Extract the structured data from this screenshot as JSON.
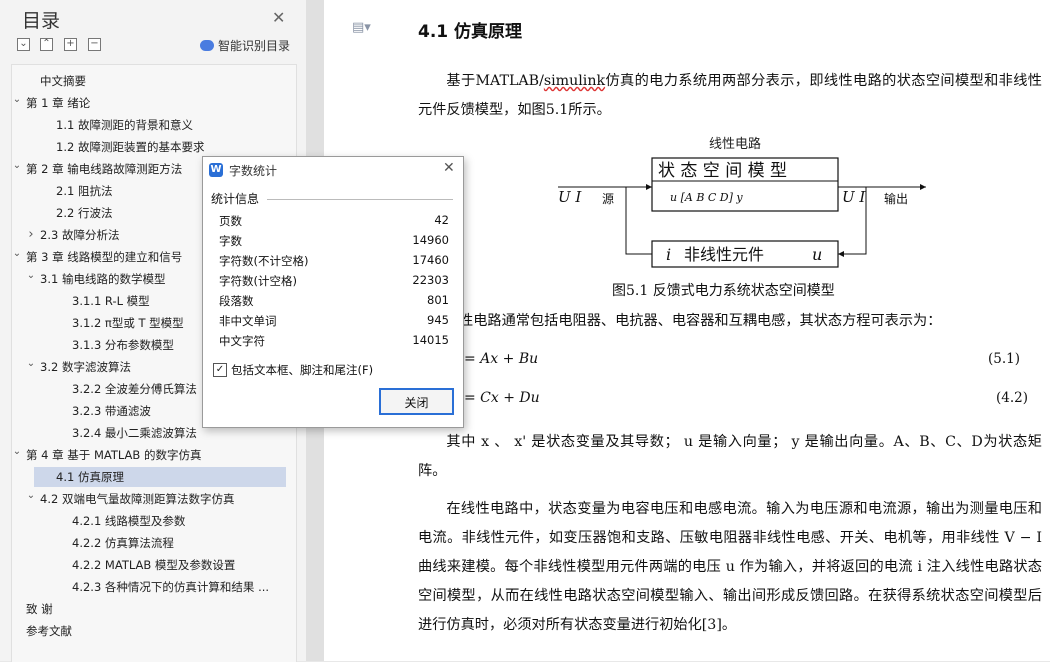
{
  "sidebar": {
    "title": "目录",
    "smart_label": "智能识别目录",
    "toolbar": [
      "⌄",
      "⌃",
      "+",
      "−"
    ],
    "items": [
      {
        "label": "中文摘要",
        "level": 1,
        "caret": ""
      },
      {
        "label": "第 1 章  绪论",
        "level": 0,
        "caret": "v"
      },
      {
        "label": "1.1 故障测距的背景和意义",
        "level": 2,
        "caret": ""
      },
      {
        "label": "1.2 故障测距装置的基本要求",
        "level": 2,
        "caret": ""
      },
      {
        "label": "第 2 章  输电线路故障测距方法",
        "level": 0,
        "caret": "v"
      },
      {
        "label": "2.1 阻抗法",
        "level": 2,
        "caret": ""
      },
      {
        "label": "2.2 行波法",
        "level": 2,
        "caret": ""
      },
      {
        "label": "2.3 故障分析法",
        "level": 1,
        "caret": ">"
      },
      {
        "label": "第 3 章  线路模型的建立和信号",
        "level": 0,
        "caret": "v"
      },
      {
        "label": "3.1 输电线路的数学模型",
        "level": 1,
        "caret": "v"
      },
      {
        "label": "3.1.1 R-L 模型",
        "level": 3,
        "caret": ""
      },
      {
        "label": "3.1.2 π型或 T 型模型",
        "level": 3,
        "caret": ""
      },
      {
        "label": "3.1.3  分布参数模型",
        "level": 3,
        "caret": ""
      },
      {
        "label": "3.2 数字滤波算法",
        "level": 1,
        "caret": "v"
      },
      {
        "label": "3.2.2  全波差分傅氏算法",
        "level": 3,
        "caret": ""
      },
      {
        "label": "3.2.3  带通滤波",
        "level": 3,
        "caret": ""
      },
      {
        "label": "3.2.4  最小二乘滤波算法",
        "level": 3,
        "caret": ""
      },
      {
        "label": "第 4 章  基于 MATLAB 的数字仿真",
        "level": 0,
        "caret": "v"
      },
      {
        "label": "4.1 仿真原理",
        "level": 2,
        "caret": "",
        "selected": true
      },
      {
        "label": "4.2 双端电气量故障测距算法数字仿真",
        "level": 1,
        "caret": "v"
      },
      {
        "label": "4.2.1 线路模型及参数",
        "level": 3,
        "caret": ""
      },
      {
        "label": "4.2.2 仿真算法流程",
        "level": 3,
        "caret": ""
      },
      {
        "label": "4.2.2 MATLAB 模型及参数设置",
        "level": 3,
        "caret": ""
      },
      {
        "label": "4.2.3 各种情况下的仿真计算和结果 ...",
        "level": 3,
        "caret": ""
      },
      {
        "label": "致   谢",
        "level": 0,
        "caret": ""
      },
      {
        "label": "参考文献",
        "level": 0,
        "caret": ""
      }
    ]
  },
  "document": {
    "heading": "4.1 仿真原理",
    "p1_a": "基于MATLAB/",
    "p1_b": "simulink",
    "p1_c": "仿真的电力系统用两部分表示，即线性电路的状态空间模型和非线性元件反馈模型，如图5.1所示。",
    "diagram": {
      "top_label": "线性电路",
      "box_top": "状 态 空 间 模 型",
      "box_sub": "u  [A   B   C   D]    y",
      "input": "U  I",
      "input_suffix": "源",
      "output": "U  I",
      "output_suffix": "输出",
      "feedback_i": "i",
      "feedback_text": "非线性元件",
      "feedback_u": "u"
    },
    "caption": "图5.1  反馈式电力系统状态空间模型",
    "p2": "性电路通常包括电阻器、电抗器、电容器和互耦电感，其状态方程可表示为：",
    "eq1": "= Ax + Bu",
    "eq1_no": "(5.1)",
    "eq2": "= Cx + Du",
    "eq2_no": "(4.2)",
    "p3": "其中 x 、 x' 是状态变量及其导数； u 是输入向量； y 是输出向量。A、B、C、D为状态矩阵。",
    "p4": "在线性电路中，状态变量为电容电压和电感电流。输入为电压源和电流源，输出为测量电压和电流。非线性元件，如变压器饱和支路、压敏电阻器非线性电感、开关、电机等，用非线性 V − I 曲线来建模。每个非线性模型用元件两端的电压 u 作为输入，并将返回的电流 i 注入线性电路状态空间模型，从而在线性电路状态空间模型输入、输出间形成反馈回路。在获得系统状态空间模型后进行仿真时，必须对所有状态变量进行初始化[3]。"
  },
  "dialog": {
    "title": "字数统计",
    "section": "统计信息",
    "stats": [
      {
        "label": "页数",
        "value": "42"
      },
      {
        "label": "字数",
        "value": "14960"
      },
      {
        "label": "字符数(不计空格)",
        "value": "17460"
      },
      {
        "label": "字符数(计空格)",
        "value": "22303"
      },
      {
        "label": "段落数",
        "value": "801"
      },
      {
        "label": "非中文单词",
        "value": "945"
      },
      {
        "label": "中文字符",
        "value": "14015"
      }
    ],
    "checkbox_label": "包括文本框、脚注和尾注(F)",
    "checked": true,
    "ok_label": "关闭"
  }
}
